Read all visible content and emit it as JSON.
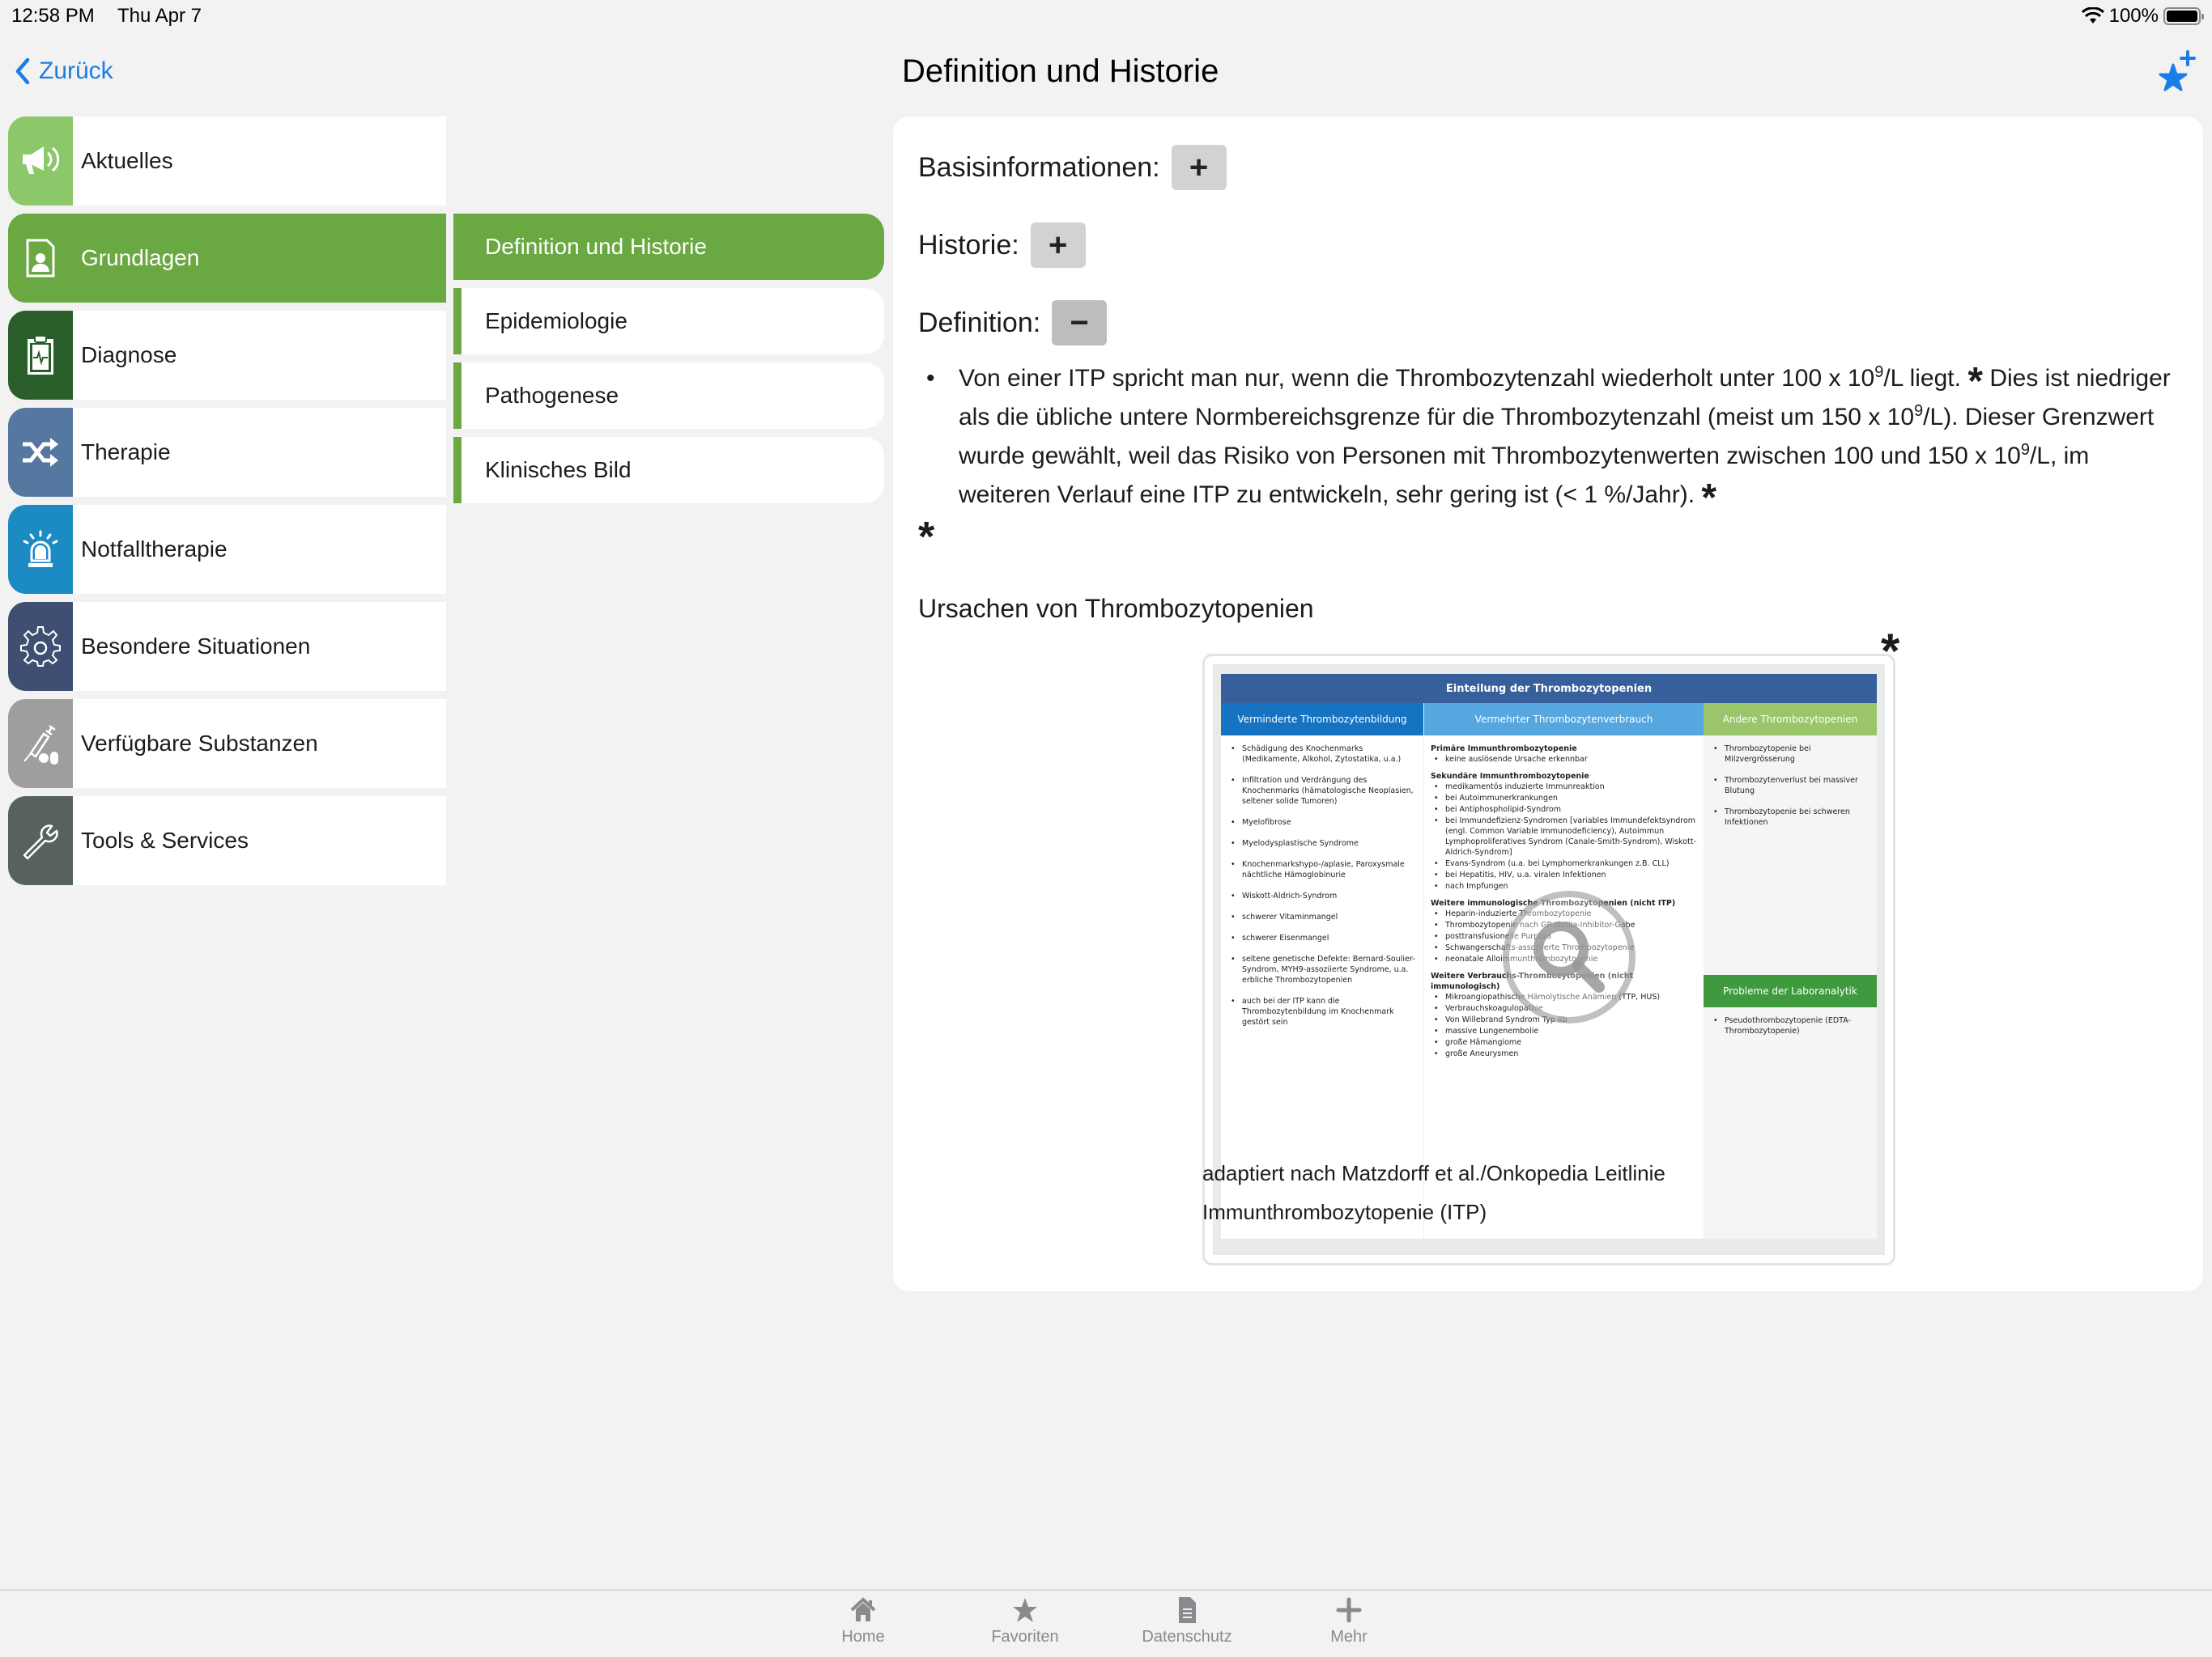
{
  "status_bar": {
    "time": "12:58 PM",
    "date": "Thu Apr 7",
    "battery": "100%",
    "battery_level": 1.0
  },
  "nav": {
    "back_label": "Zurück",
    "title": "Definition und Historie",
    "favorite_add_icon": "star-plus-icon"
  },
  "sidebar": {
    "items": [
      {
        "label": "Aktuelles",
        "icon": "megaphone-icon",
        "color": "#8cc76a",
        "active": false
      },
      {
        "label": "Grundlagen",
        "icon": "document-person-icon",
        "color": "#6aa842",
        "active": true
      },
      {
        "label": "Diagnose",
        "icon": "clipboard-pulse-icon",
        "color": "#2a5e2a",
        "active": false
      },
      {
        "label": "Therapie",
        "icon": "shuffle-icon",
        "color": "#5677a0",
        "active": false
      },
      {
        "label": "Notfalltherapie",
        "icon": "siren-icon",
        "color": "#1c8ac3",
        "active": false
      },
      {
        "label": "Besondere Situationen",
        "icon": "gear-icon",
        "color": "#3e4f72",
        "active": false
      },
      {
        "label": "Verfügbare Substanzen",
        "icon": "syringe-pills-icon",
        "color": "#9e9e9e",
        "active": false
      },
      {
        "label": "Tools & Services",
        "icon": "wrench-icon",
        "color": "#576260",
        "active": false
      }
    ]
  },
  "subnav": {
    "items": [
      {
        "label": "Definition und Historie",
        "active": true
      },
      {
        "label": "Epidemiologie",
        "active": false
      },
      {
        "label": "Pathogenese",
        "active": false
      },
      {
        "label": "Klinisches Bild",
        "active": false
      }
    ]
  },
  "content": {
    "sections": [
      {
        "label": "Basisinformationen:",
        "toggle": "+",
        "expanded": false
      },
      {
        "label": "Historie:",
        "toggle": "+",
        "expanded": false
      },
      {
        "label": "Definition:",
        "toggle": "−",
        "expanded": true
      }
    ],
    "definition": {
      "p1": "Von einer ITP spricht man nur, wenn die Thrombozytenzahl wiederholt unter 100 x 10",
      "p1_sup": "9",
      "p1_end": "/L liegt.",
      "p2": " Dies ist niedriger als die übliche untere Normbereichsgrenze für die Thrombozytenzahl (meist um 150 x 10",
      "p2_sup": "9",
      "p2_end": "/L). Dieser Grenzwert wurde gewählt, weil das Risiko von Personen mit Thrombozytenwerten zwischen 100 und 150 x 10",
      "p3_sup": "9",
      "p3_end": "/L, im weiteren Verlauf eine ITP zu entwickeln, sehr gering ist (< 1 %/Jahr).",
      "asterisk": "*"
    },
    "subheading": "Ursachen von Thrombozytopenien",
    "figure": {
      "title": "Einteilung der Thrombozytopenien",
      "col1": {
        "header": "Verminderte Thrombozytenbildung",
        "items": [
          "Schädigung des Knochenmarks (Medikamente, Alkohol, Zytostatika, u.a.)",
          "Infiltration und Verdrängung des Knochenmarks (hämatologische Neoplasien, seltener solide Tumoren)",
          "Myelofibrose",
          "Myelodysplastische Syndrome",
          "Knochenmarkshypo-/aplasie, Paroxysmale nächtliche Hämoglobinurie",
          "Wiskott-Aldrich-Syndrom",
          "schwerer Vitaminmangel",
          "schwerer Eisenmangel",
          "seltene genetische Defekte: Bernard-Soulier-Syndrom, MYH9-assoziierte Syndrome, u.a. erbliche Thrombozytopenien",
          "auch bei der ITP kann die Thrombozytenbildung im Knochenmark gestört sein"
        ]
      },
      "col2": {
        "header": "Vermehrter Thrombozytenverbrauch",
        "groups": [
          {
            "title": "Primäre Immunthrombozytopenie",
            "items": [
              "keine auslösende Ursache erkennbar"
            ]
          },
          {
            "title": "Sekundäre Immunthrombozytopenie",
            "items": [
              "medikamentös induzierte Immunreaktion",
              "bei Autoimmunerkrankungen",
              "bei Antiphospholipid-Syndrom",
              "bei Immundefizienz-Syndromen [variables Immundefektsyndrom (engl. Common Variable Immunodeficiency), Autoimmun Lymphoproliferatives Syndrom (Canale-Smith-Syndrom), Wiskott-Aldrich-Syndrom]",
              "Evans-Syndrom (u.a. bei Lymphomerkrankungen z.B. CLL)",
              "bei Hepatitis, HIV, u.a. viralen Infektionen",
              "nach Impfungen"
            ]
          },
          {
            "title": "Weitere immunologische Thrombozytopenien (nicht ITP)",
            "items": [
              "Heparin-induzierte Thrombozytopenie",
              "Thrombozytopenie nach GP IIb/IIIa-Inhibitor-Gabe",
              "posttransfusionelle Purpura",
              "Schwangerschafts-assoziierte Thrombozytopenie",
              "neonatale Alloimmunthrombozytopenie"
            ]
          },
          {
            "title": "Weitere Verbrauchs-Thrombozytopenien (nicht immunologisch)",
            "items": [
              "Mikroangiopathische Hämolytische Anämien (TTP, HUS)",
              "Verbrauchskoagulopathie",
              "Von Willebrand Syndrom Typ IIb",
              "massive Lungenembolie",
              "große Hämangiome",
              "große Aneurysmen"
            ]
          }
        ]
      },
      "col3": {
        "header": "Andere Thrombozytopenien",
        "items": [
          "Thrombozytopenie bei Milzvergrösserung",
          "Thrombozytenverlust bei massiver Blutung",
          "Thrombozytopenie bei schweren Infektionen"
        ],
        "lab_header": "Probleme der Laboranalytik",
        "lab_items": [
          "Pseudothrombozytopenie (EDTA-Thrombozytopenie)"
        ]
      }
    },
    "caption_line1": "adaptiert nach Matzdorff et al./Onkopedia Leitlinie",
    "caption_line2": "Immunthrombozytopenie (ITP)"
  },
  "tabbar": {
    "items": [
      {
        "label": "Home",
        "icon": "home-icon"
      },
      {
        "label": "Favoriten",
        "icon": "star-icon"
      },
      {
        "label": "Datenschutz",
        "icon": "document-icon"
      },
      {
        "label": "Mehr",
        "icon": "plus-icon"
      }
    ]
  }
}
